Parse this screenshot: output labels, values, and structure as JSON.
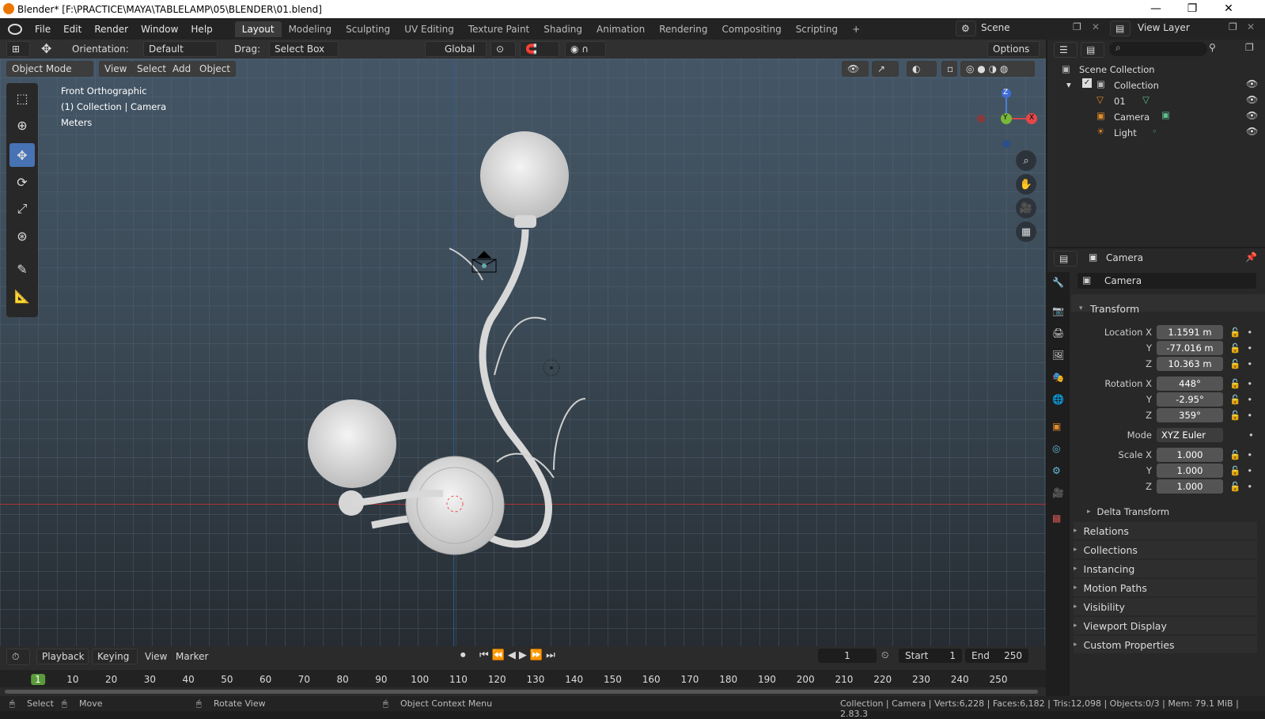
{
  "window": {
    "title": "Blender* [F:\\PRACTICE\\MAYA\\TABLELAMP\\05\\BLENDER\\01.blend]"
  },
  "menus": [
    "File",
    "Edit",
    "Render",
    "Window",
    "Help"
  ],
  "workspaces": [
    "Layout",
    "Modeling",
    "Sculpting",
    "UV Editing",
    "Texture Paint",
    "Shading",
    "Animation",
    "Rendering",
    "Compositing",
    "Scripting"
  ],
  "scene": {
    "scene_label": "Scene",
    "viewlayer_label": "View Layer"
  },
  "header": {
    "orientation_label": "Orientation:",
    "orientation_value": "Default",
    "drag_label": "Drag:",
    "drag_value": "Select Box",
    "transform_space": "Global",
    "options": "Options"
  },
  "view_header": {
    "mode": "Object Mode",
    "view": "View",
    "select": "Select",
    "add": "Add",
    "object": "Object"
  },
  "viewport_info": {
    "line1": "Front Orthographic",
    "line2": "(1) Collection | Camera",
    "line3": "Meters"
  },
  "gizmo": {
    "z": "Z",
    "y": "Y",
    "x": "X"
  },
  "outliner": {
    "scene_collection": "Scene Collection",
    "collection": "Collection",
    "items": [
      "01",
      "Camera",
      "Light"
    ]
  },
  "properties": {
    "object_name": "Camera",
    "data_name": "Camera",
    "transform": "Transform",
    "location_label": "Location X",
    "loc_x": "1.1591 m",
    "loc_y": "-77.016 m",
    "loc_z": "10.363 m",
    "rotation_label": "Rotation X",
    "rot_x": "448°",
    "rot_y": "-2.95°",
    "rot_z": "359°",
    "mode_label": "Mode",
    "mode_value": "XYZ Euler",
    "scale_label": "Scale X",
    "scale_x": "1.000",
    "scale_y": "1.000",
    "scale_z": "1.000",
    "y_label": "Y",
    "z_label": "Z",
    "delta": "Delta Transform",
    "sections": [
      "Relations",
      "Collections",
      "Instancing",
      "Motion Paths",
      "Visibility",
      "Viewport Display",
      "Custom Properties"
    ]
  },
  "timeline": {
    "playback": "Playback",
    "keying": "Keying",
    "view": "View",
    "marker": "Marker",
    "current_frame": "1",
    "start_label": "Start",
    "start": "1",
    "end_label": "End",
    "end": "250",
    "ticks": [
      "1",
      "10",
      "20",
      "30",
      "40",
      "50",
      "60",
      "70",
      "80",
      "90",
      "100",
      "110",
      "120",
      "130",
      "140",
      "150",
      "160",
      "170",
      "180",
      "190",
      "200",
      "210",
      "220",
      "230",
      "240",
      "250"
    ]
  },
  "status": {
    "select": "Select",
    "move": "Move",
    "rotate": "Rotate View",
    "context": "Object Context Menu",
    "stats": "Collection | Camera | Verts:6,228 | Faces:6,182 | Tris:12,098 | Objects:0/3 | Mem: 79.1 MiB | 2.83.3"
  }
}
